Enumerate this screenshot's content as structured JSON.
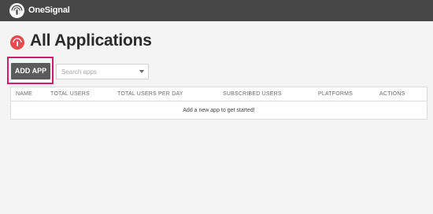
{
  "brand": {
    "name": "OneSignal",
    "logo_icon": "onesignal-logo-icon"
  },
  "page": {
    "title": "All Applications",
    "title_icon": "onesignal-app-icon"
  },
  "toolbar": {
    "add_label": "ADD APP",
    "search_placeholder": "Search apps",
    "search_value": ""
  },
  "table": {
    "columns": [
      "NAME",
      "TOTAL USERS",
      "TOTAL USERS PER DAY",
      "SUBSCRIBED USERS",
      "PLATFORMS",
      "ACTIONS"
    ],
    "empty_message": "Add a new app to get started!"
  },
  "colors": {
    "topbar": "#474747",
    "accent_red": "#e54b4d",
    "highlight": "#d5196f",
    "button": "#5b5b5b"
  }
}
